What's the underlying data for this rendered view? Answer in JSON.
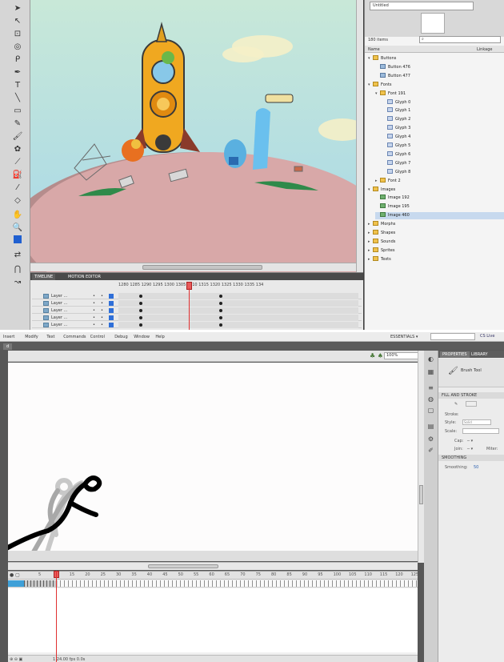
{
  "top": {
    "library": {
      "dropdown": "Untitled",
      "item_count": "180 items",
      "search_placeholder": "",
      "col_name": "Name",
      "col_linkage": "Linkage",
      "tree": [
        {
          "label": "Buttons",
          "kind": "folder",
          "depth": 0,
          "open": true
        },
        {
          "label": "Button 476",
          "kind": "btn",
          "depth": 1
        },
        {
          "label": "Button 477",
          "kind": "btn",
          "depth": 1
        },
        {
          "label": "Fonts",
          "kind": "folder",
          "depth": 0,
          "open": true
        },
        {
          "label": "Font 191",
          "kind": "folder",
          "depth": 1,
          "open": true
        },
        {
          "label": "Glyph 0",
          "kind": "glyph",
          "depth": 2
        },
        {
          "label": "Glyph 1",
          "kind": "glyph",
          "depth": 2
        },
        {
          "label": "Glyph 2",
          "kind": "glyph",
          "depth": 2
        },
        {
          "label": "Glyph 3",
          "kind": "glyph",
          "depth": 2
        },
        {
          "label": "Glyph 4",
          "kind": "glyph",
          "depth": 2
        },
        {
          "label": "Glyph 5",
          "kind": "glyph",
          "depth": 2
        },
        {
          "label": "Glyph 6",
          "kind": "glyph",
          "depth": 2
        },
        {
          "label": "Glyph 7",
          "kind": "glyph",
          "depth": 2
        },
        {
          "label": "Glyph 8",
          "kind": "glyph",
          "depth": 2
        },
        {
          "label": "Font 2",
          "kind": "folder",
          "depth": 1,
          "open": false
        },
        {
          "label": "Images",
          "kind": "folder",
          "depth": 0,
          "open": true
        },
        {
          "label": "Image 192",
          "kind": "img",
          "depth": 1
        },
        {
          "label": "Image 195",
          "kind": "img",
          "depth": 1
        },
        {
          "label": "Image 460",
          "kind": "img",
          "depth": 1,
          "selected": true
        },
        {
          "label": "Morphs",
          "kind": "folder",
          "depth": 0,
          "open": false
        },
        {
          "label": "Shapes",
          "kind": "folder",
          "depth": 0,
          "open": false
        },
        {
          "label": "Sounds",
          "kind": "folder",
          "depth": 0,
          "open": false
        },
        {
          "label": "Sprites",
          "kind": "folder",
          "depth": 0,
          "open": false
        },
        {
          "label": "Texts",
          "kind": "folder",
          "depth": 0,
          "open": false
        }
      ]
    },
    "timeline": {
      "tab_timeline": "TIMELINE",
      "tab_motion": "MOTION EDITOR",
      "ruler": "1280   1285   1290   1295   1300   1305   1310   1315   1320   1325   1330   1335   134",
      "layers": [
        "Layer ...",
        "Layer ...",
        "Layer ...",
        "Layer ...",
        "Layer ..."
      ]
    }
  },
  "bottom": {
    "menu": [
      "Insert",
      "Modify",
      "Text",
      "Commands",
      "Control",
      "Debug",
      "Window",
      "Help"
    ],
    "essentials": "ESSENTIALS ▾",
    "cs_live": "CS Live",
    "doc_tab": "d",
    "zoom": "100%",
    "timeline_ruler": [
      "5",
      "10",
      "15",
      "20",
      "25",
      "30",
      "35",
      "40",
      "45",
      "50",
      "55",
      "60",
      "65",
      "70",
      "75",
      "80",
      "85",
      "90",
      "95",
      "100",
      "105",
      "110",
      "115",
      "120",
      "125"
    ],
    "status": "1  24.00 fps  0.0s",
    "properties": {
      "tab_properties": "PROPERTIES",
      "tab_library": "LIBRARY",
      "tool_name": "Brush Tool",
      "section_fill": "FILL AND STROKE",
      "stroke_label": "Stroke:",
      "style_label": "Style:",
      "style_value": "Solid",
      "scale_label": "Scale:",
      "cap_label": "Cap:",
      "join_label": "Join:",
      "miter_label": "Miter:",
      "section_smoothing": "SMOOTHING",
      "smoothing_label": "Smoothing:",
      "smoothing_value": "50"
    }
  }
}
